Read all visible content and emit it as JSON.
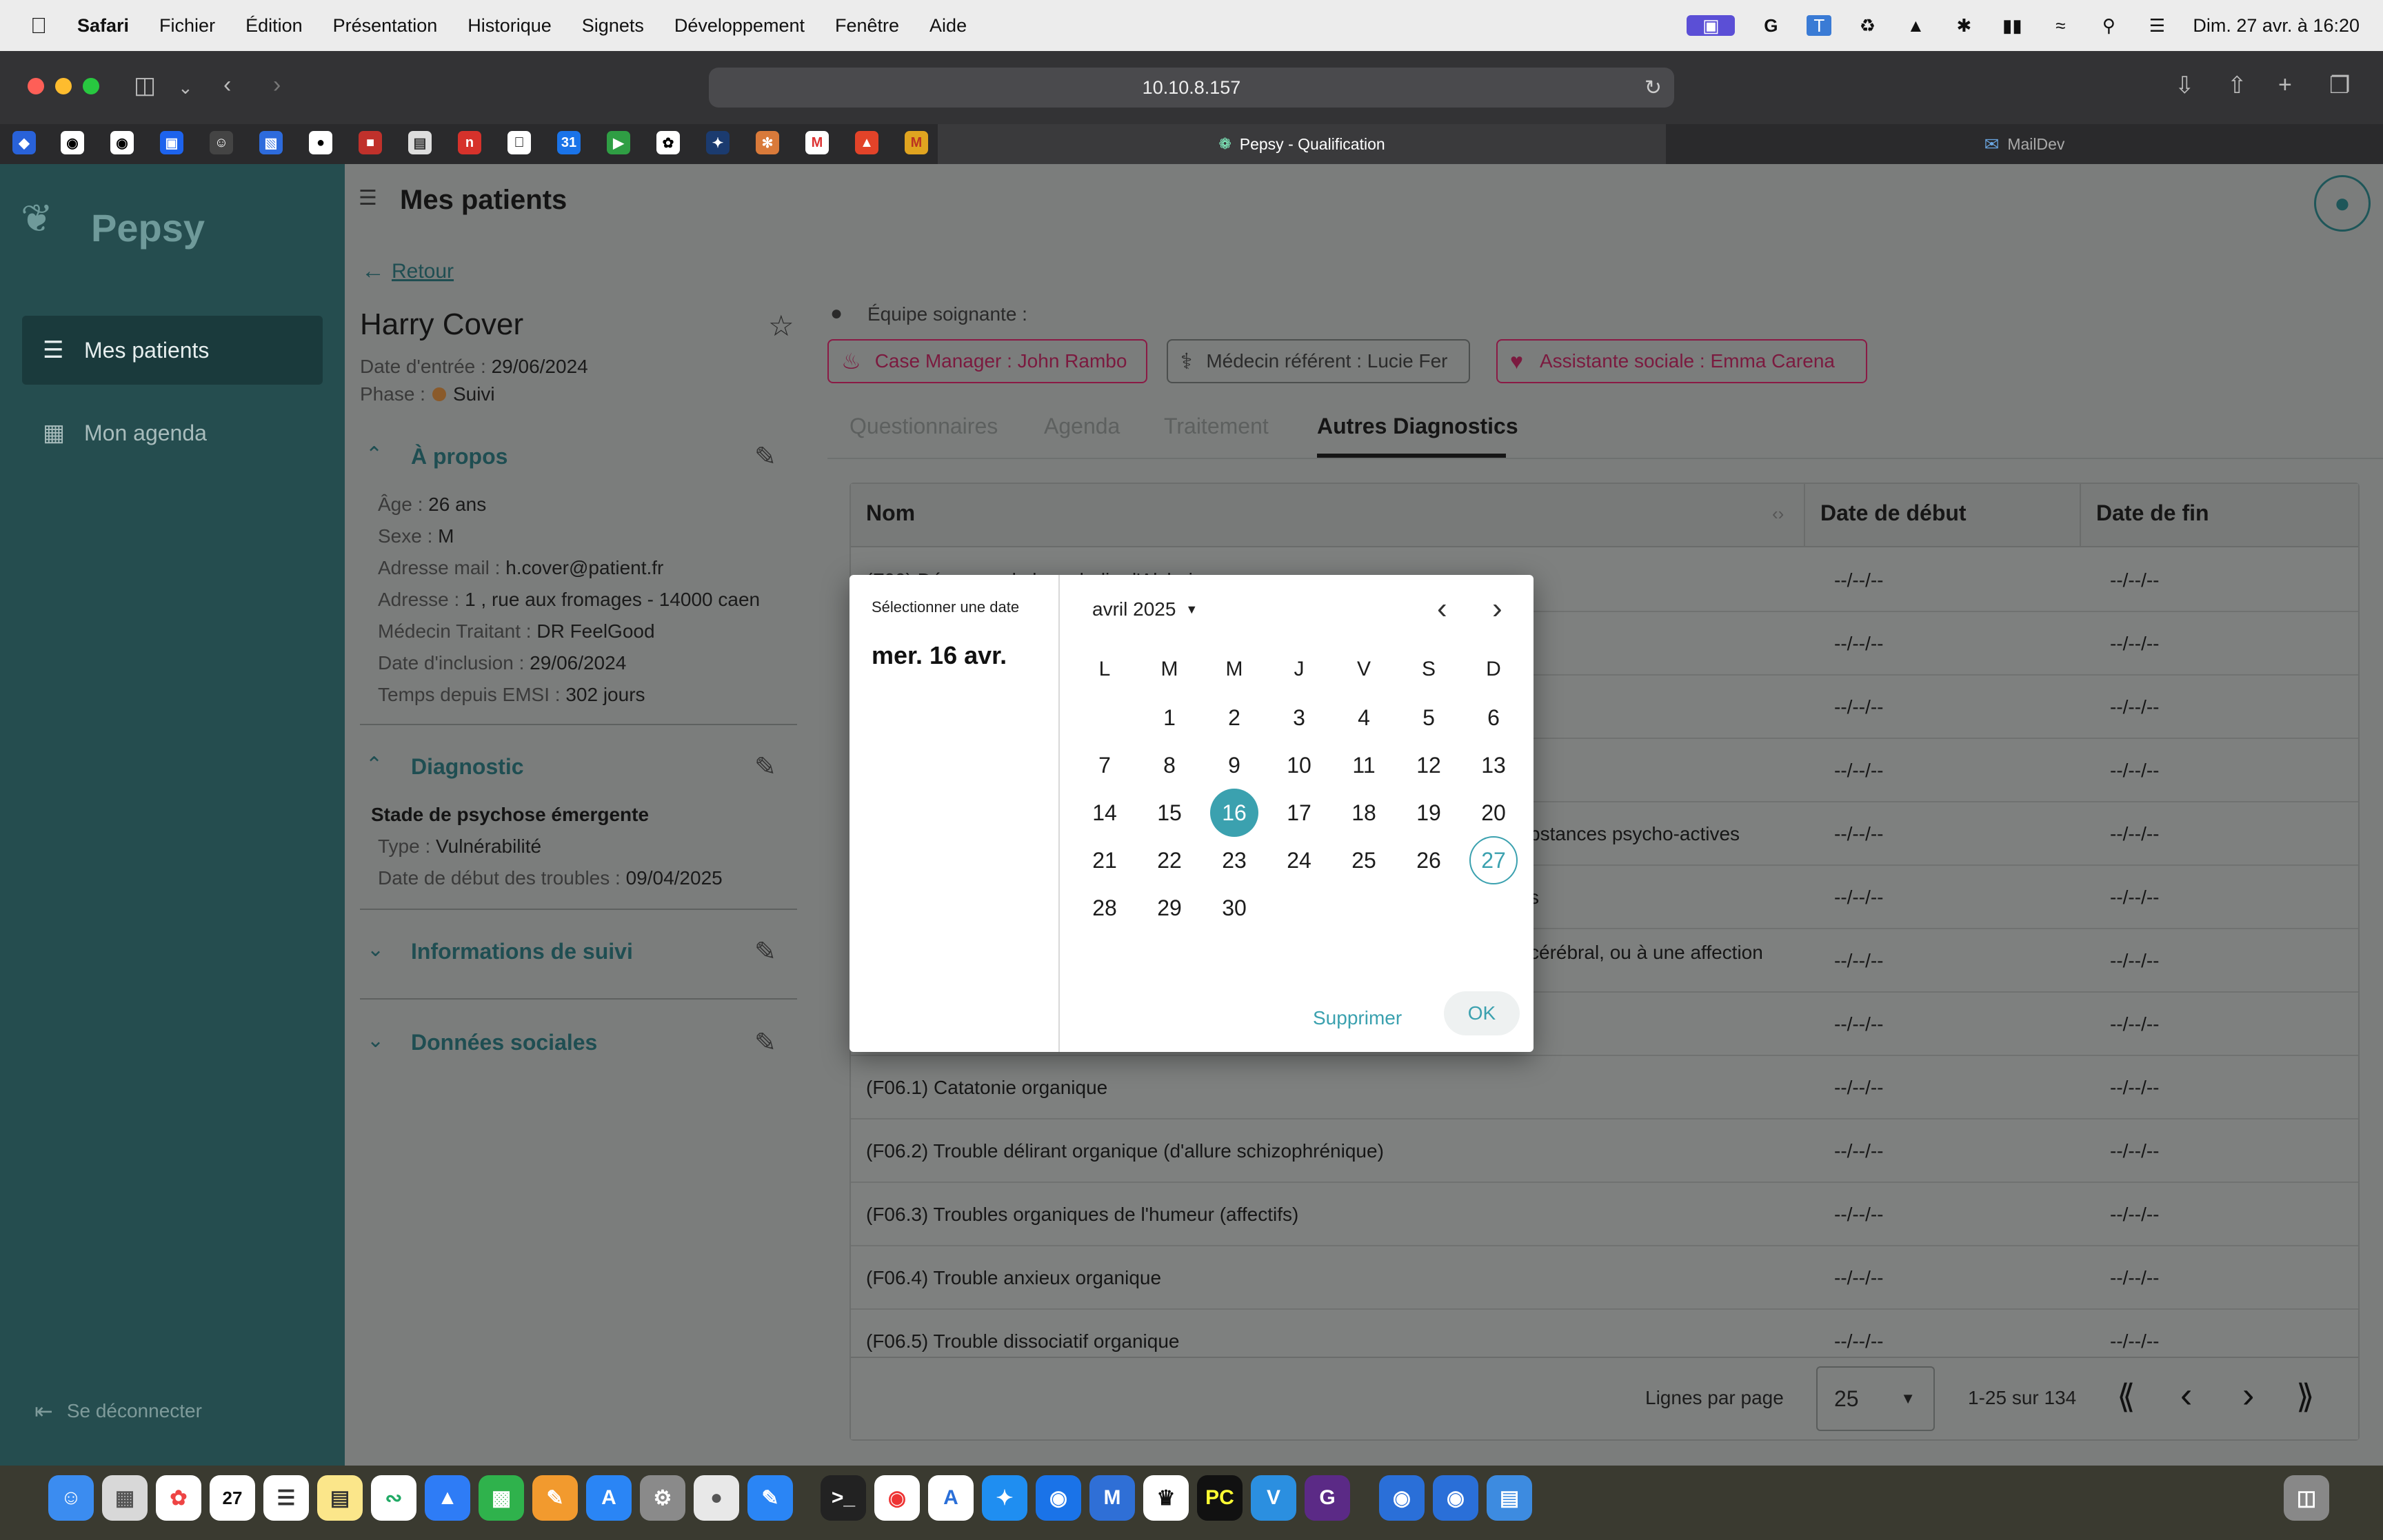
{
  "menubar": {
    "app": "Safari",
    "items": [
      "Fichier",
      "Édition",
      "Présentation",
      "Historique",
      "Signets",
      "Développement",
      "Fenêtre",
      "Aide"
    ],
    "clock": "Dim. 27 avr. à 16:20"
  },
  "browser": {
    "url": "10.10.8.157",
    "tabs": [
      {
        "label": "Pepsy - Qualification",
        "active": true
      },
      {
        "label": "MailDev",
        "active": false
      }
    ]
  },
  "app": {
    "brand": "Pepsy",
    "nav": [
      {
        "label": "Mes patients",
        "icon": "patients-list-icon",
        "active": true
      },
      {
        "label": "Mon agenda",
        "icon": "calendar-icon",
        "active": false
      }
    ],
    "logout": "Se déconnecter",
    "page_title": "Mes patients"
  },
  "patient": {
    "back": "Retour",
    "name": "Harry Cover",
    "entry_label": "Date d'entrée :",
    "entry_value": "29/06/2024",
    "phase_label": "Phase :",
    "phase_value": "Suivi",
    "about_title": "À propos",
    "about": [
      {
        "label": "Âge :",
        "value": "26 ans"
      },
      {
        "label": "Sexe :",
        "value": "M"
      },
      {
        "label": "Adresse mail :",
        "value": "h.cover@patient.fr"
      },
      {
        "label": "Adresse :",
        "value": "1 , rue aux fromages - 14000 caen"
      },
      {
        "label": "Médecin Traitant :",
        "value": "DR FeelGood"
      },
      {
        "label": "Date d'inclusion :",
        "value": "29/06/2024"
      },
      {
        "label": "Temps depuis EMSI :",
        "value": "302 jours"
      }
    ],
    "diagnostic_title": "Diagnostic",
    "diagnostic_stage": "Stade de psychose émergente",
    "diagnostic": [
      {
        "label": "Type :",
        "value": "Vulnérabilité"
      },
      {
        "label": "Date de début des troubles :",
        "value": "09/04/2025"
      }
    ],
    "followup_title": "Informations de suivi",
    "social_title": "Données sociales"
  },
  "team": {
    "label": "Équipe soignante :",
    "chips": [
      "Case Manager : John Rambo",
      "Médecin référent : Lucie Fer",
      "Assistante sociale : Emma Carena"
    ]
  },
  "tabs": [
    "Questionnaires",
    "Agenda",
    "Traitement",
    "Autres Diagnostics"
  ],
  "table": {
    "headers": [
      "Nom",
      "Date de début",
      "Date de fin"
    ],
    "rows": [
      {
        "name": "(F00) Démence de la maladie d'Alzheimer",
        "start": "--/--/--",
        "end": "--/--/--"
      },
      {
        "name": "",
        "start": "--/--/--",
        "end": "--/--/--"
      },
      {
        "name": "",
        "start": "--/--/--",
        "end": "--/--/--"
      },
      {
        "name": "",
        "start": "--/--/--",
        "end": "--/--/--"
      },
      {
        "name": "bstances psycho-actives",
        "start": "--/--/--",
        "end": "--/--/--"
      },
      {
        "name": "s",
        "start": "--/--/--",
        "end": "--/--/--"
      },
      {
        "name": "cérébral, ou à une affection",
        "start": "--/--/--",
        "end": "--/--/--"
      },
      {
        "name": "",
        "start": "--/--/--",
        "end": "--/--/--"
      },
      {
        "name": "(F06.1) Catatonie organique",
        "start": "--/--/--",
        "end": "--/--/--"
      },
      {
        "name": "(F06.2) Trouble délirant organique (d'allure schizophrénique)",
        "start": "--/--/--",
        "end": "--/--/--"
      },
      {
        "name": "(F06.3) Troubles organiques de l'humeur (affectifs)",
        "start": "--/--/--",
        "end": "--/--/--"
      },
      {
        "name": "(F06.4) Trouble anxieux organique",
        "start": "--/--/--",
        "end": "--/--/--"
      },
      {
        "name": "(F06.5) Trouble dissociatif organique",
        "start": "--/--/--",
        "end": "--/--/--"
      }
    ],
    "rows_per_page_label": "Lignes par page",
    "rows_per_page": "25",
    "range": "1-25 sur 134"
  },
  "datepicker": {
    "header_label": "Sélectionner une date",
    "selected_display": "mer. 16 avr.",
    "month_label": "avril 2025",
    "weekdays": [
      "L",
      "M",
      "M",
      "J",
      "V",
      "S",
      "D"
    ],
    "first_weekday_offset": 1,
    "days_in_month": 30,
    "selected_day": 16,
    "today_day": 27,
    "clear_label": "Supprimer",
    "ok_label": "OK"
  },
  "colors": {
    "sidebar": "#254d4f",
    "accent": "#3ba1af",
    "chip": "#7b1a3f"
  }
}
